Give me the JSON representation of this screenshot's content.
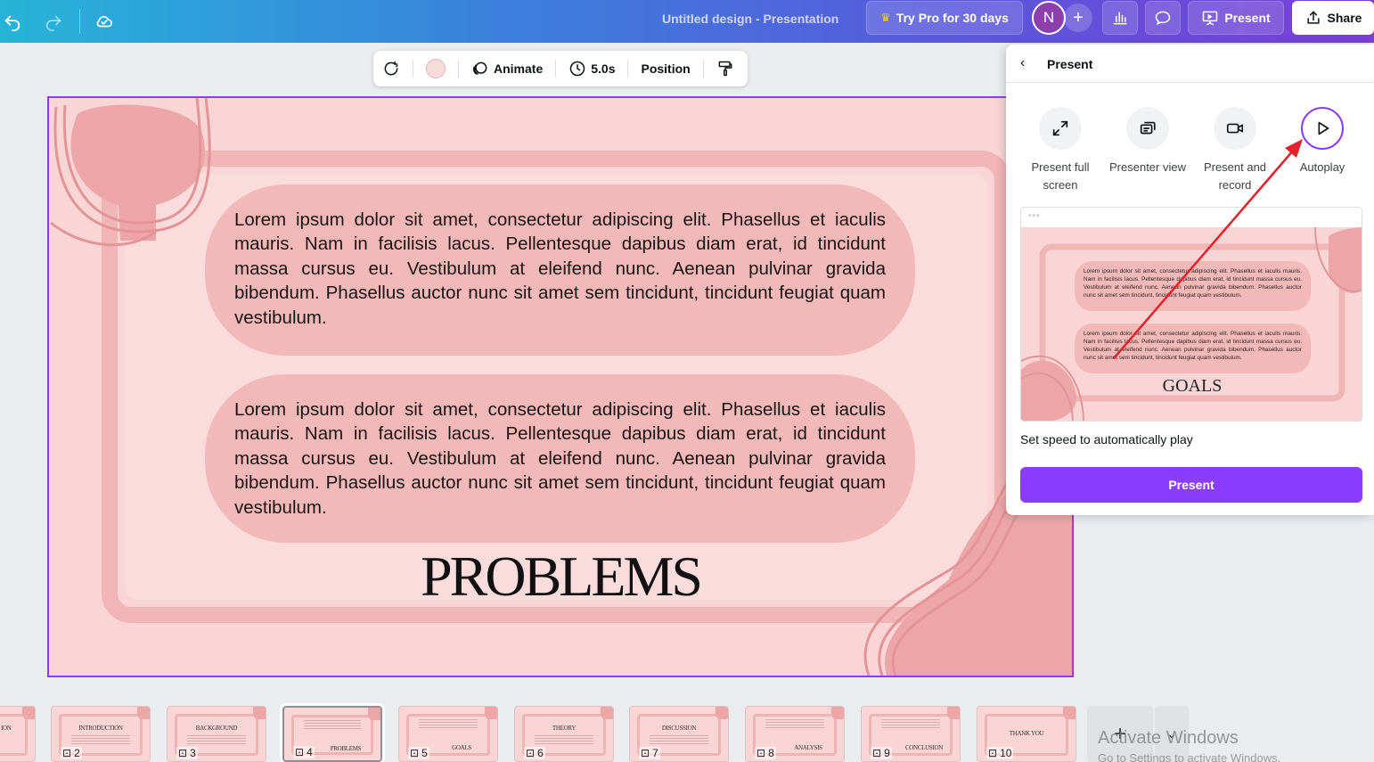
{
  "topbar": {
    "design_title": "Untitled design - Presentation",
    "try_pro_label": "Try Pro for 30 days",
    "avatar_initial": "N",
    "present_label": "Present",
    "share_label": "Share"
  },
  "toolbar": {
    "animate_label": "Animate",
    "duration_label": "5.0s",
    "position_label": "Position"
  },
  "slide": {
    "paragraph_1": "Lorem ipsum dolor sit amet, consectetur adipiscing elit. Phasellus et iaculis mauris. Nam in facilisis lacus. Pellentesque dapibus diam erat, id tincidunt massa cursus eu. Vestibulum at eleifend nunc. Aenean pulvinar gravida bibendum. Phasellus auctor nunc sit amet sem tincidunt, tincidunt feugiat quam vestibulum.",
    "paragraph_2": "Lorem ipsum dolor sit amet, consectetur adipiscing elit. Phasellus et iaculis mauris. Nam in facilisis lacus. Pellentesque dapibus diam erat, id tincidunt massa cursus eu. Vestibulum at eleifend nunc. Aenean pulvinar gravida bibendum. Phasellus auctor nunc sit amet sem tincidunt, tincidunt feugiat quam vestibulum.",
    "heading": "PROBLEMS"
  },
  "present_panel": {
    "title": "Present",
    "modes": [
      {
        "label": "Present full screen",
        "icon": "expand-icon"
      },
      {
        "label": "Presenter view",
        "icon": "presenter-view-icon"
      },
      {
        "label": "Present and record",
        "icon": "video-camera-icon"
      },
      {
        "label": "Autoplay",
        "icon": "play-icon"
      }
    ],
    "preview_paragraph_1": "Lorem ipsum dolor sit amet, consectetur adipiscing elit. Phasellus et iaculis mauris. Nam in facilisis lacus. Pellentesque dapibus diam erat, id tincidunt massa cursus eu. Vestibulum at eleifend nunc. Aenean pulvinar gravida bibendum. Phasellus auctor nunc sit amet sem tincidunt, tincidunt feugiat quam vestibulum.",
    "preview_paragraph_2": "Lorem ipsum dolor sit amet, consectetur adipiscing elit. Phasellus et iaculis mauris. Nam in facilisis lacus. Pellentesque dapibus diam erat, id tincidunt massa cursus eu. Vestibulum at eleifend nunc. Aenean pulvinar gravida bibendum. Phasellus auctor nunc sit amet sem tincidunt, tincidunt feugiat quam vestibulum.",
    "preview_heading": "GOALS",
    "speed_label": "Set speed to automatically play",
    "present_button": "Present"
  },
  "filmstrip": {
    "pages": [
      {
        "num": "",
        "title": "ION"
      },
      {
        "num": "2",
        "title": "INTRODUCTION"
      },
      {
        "num": "3",
        "title": "BACKGROUND"
      },
      {
        "num": "4",
        "title": "PROBLEMS"
      },
      {
        "num": "5",
        "title": "GOALS"
      },
      {
        "num": "6",
        "title": "THEORY"
      },
      {
        "num": "7",
        "title": "DISCUSSION"
      },
      {
        "num": "8",
        "title": "ANALYSIS"
      },
      {
        "num": "9",
        "title": "CONCLUSION"
      },
      {
        "num": "10",
        "title": "THANK YOU"
      }
    ]
  },
  "os_watermark": {
    "title": "Activate Windows",
    "subtitle": "Go to Settings to activate Windows."
  },
  "colors": {
    "accent": "#8b3dff",
    "slide_background": "#f9d5d6",
    "pill": "#f2b9b8",
    "annotation_arrow": "#e8202a"
  }
}
